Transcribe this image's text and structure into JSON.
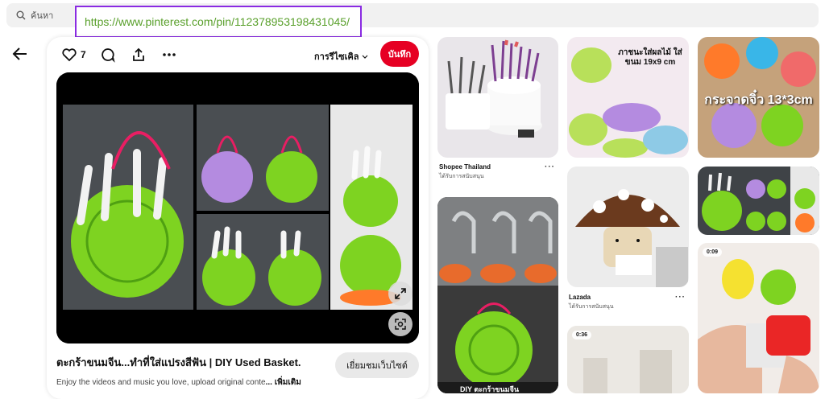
{
  "search": {
    "placeholder": "ค้นหา"
  },
  "url_overlay": {
    "url": "https://www.pinterest.com/pin/112378953198431045/"
  },
  "toolbar": {
    "like_count": "7",
    "board_label": "การรีไซเคิล",
    "save_label": "บันทึก"
  },
  "pin": {
    "title": "ตะกร้าขนมจีน...ทำที่ใส่แปรงสีฟัน | DIY Used Basket.",
    "description": "Enjoy the videos and music you love, upload original conte",
    "more_label": "... เพิ่มเติม",
    "visit_label": "เยี่ยมชมเว็บไซต์"
  },
  "tiles": {
    "t1": {
      "title": "Shopee Thailand",
      "subtitle": "ได้รับการสนับสนุน"
    },
    "t3": {
      "overlay": "ภาชนะใส่ผลไม้ ใส่ขนม 19x9 cm"
    },
    "t4": {
      "title": "Lazada",
      "subtitle": "ได้รับการสนับสนุน"
    },
    "t5": {
      "duration": "0:36"
    },
    "t6": {
      "overlay": "กระจาดจิ๋ว 13*3cm"
    },
    "t8": {
      "duration": "0:09"
    },
    "t2": {
      "caption": "DIY ตะกร้าขนมจีน"
    }
  },
  "colors": {
    "accent": "#e60023",
    "url_border": "#8a2be2",
    "url_text": "#5aa02c",
    "basket_green": "#7ed321"
  },
  "icons": [
    "search-icon",
    "back-arrow-icon",
    "heart-icon",
    "comment-icon",
    "share-icon",
    "more-icon",
    "chevron-down-icon",
    "expand-icon",
    "visual-search-icon"
  ]
}
